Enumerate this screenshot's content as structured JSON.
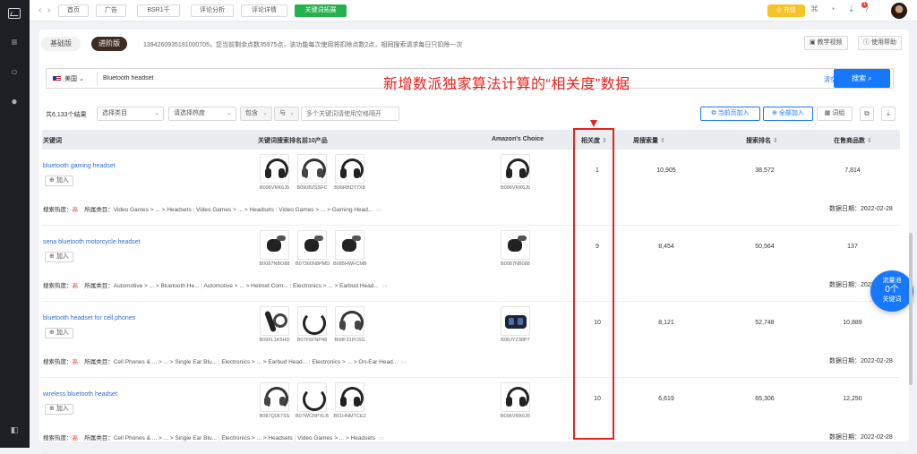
{
  "topbar": {
    "tabs": [
      "首页",
      "广告",
      "BSR1千",
      "评论分析",
      "评论详情",
      "关键词拓展"
    ],
    "charge": "充值",
    "notification_count": "1"
  },
  "header": {
    "version_basic": "基础版",
    "version_adv": "进阶版",
    "notice": "1394260935181000705，您当前剩余点数35975点，该功能每次使用将扣除点数2点，相同搜索请求每日只扣除一次",
    "tutorial": "教学视频",
    "help": "使用帮助"
  },
  "search": {
    "country": "美国",
    "value": "Bluetooth headset",
    "clear": "清空",
    "button": "搜索"
  },
  "filters": {
    "total": "共6,133个结果",
    "category": "选择类目",
    "heat": "请选择热度",
    "include": "包含",
    "and": "与",
    "keyword_placeholder": "多个关键词请使用空格隔开",
    "add_page": "当前页加入",
    "add_all": "全部加入",
    "words": "词组"
  },
  "annotation": "新增数派独家算法计算的“相关度”数据",
  "table": {
    "headers": [
      "关键词",
      "关键词搜索排名前10产品",
      "Amazon's Choice",
      "相关度",
      "周搜索量",
      "搜索排名",
      "在售商品数"
    ],
    "add_label": "加入",
    "rows": [
      {
        "keyword": "bluetooth gaming headset",
        "products": [
          "B096VRK6J5",
          "B090B2SSFC",
          "B06RBDT7X8"
        ],
        "choice": "B096VRK6J5",
        "relevance": "1",
        "weekly": "10,905",
        "rank": "38,572",
        "count": "7,814",
        "heat_label": "搜索热度：",
        "heat": "高",
        "cat_label": "所属类目：",
        "cats": [
          "Video Games > ... > Headsets",
          "Video Games > ... > Headsets",
          "Video Games > ... > Gaming Head..."
        ],
        "date": "数据日期：2022-02-28"
      },
      {
        "keyword": "sena bluetooth motorcycle headset",
        "products": [
          "B0087NBO88",
          "B07360N8PMD",
          "B085HWFCMB"
        ],
        "choice": "B0087NB088",
        "relevance": "9",
        "weekly": "8,454",
        "rank": "50,564",
        "count": "137",
        "heat_label": "搜索热度：",
        "heat": "高",
        "cat_label": "所属类目：",
        "cats": [
          "Automotive > ... > Bluetooth He...",
          "Automotive > ... > Helmet Com...",
          "Electronics > ... > Earbud Head..."
        ],
        "date": "数据日期：2022-02-28"
      },
      {
        "keyword": "bluetooth headset for cell phones",
        "products": [
          "B09FL1K5HD",
          "B07F6FNP48",
          "B09F31PC6G"
        ],
        "choice": "B08JYZ38P7",
        "relevance": "10",
        "weekly": "8,121",
        "rank": "52,748",
        "count": "10,889",
        "heat_label": "搜索热度：",
        "heat": "高",
        "cat_label": "所属类目：",
        "cats": [
          "Cell Phones & ... > ... > Single Ear Blu...",
          "Electronics > ... > Earbud Head...",
          "Electronics > ... > On-Ear Head..."
        ],
        "date": "数据日期：2022-02-28"
      },
      {
        "keyword": "wireless bluetooth headset",
        "products": [
          "B087Q067SS",
          "B07WCRPXLB",
          "B01HNMTCE2"
        ],
        "choice": "B096VRK6J5",
        "relevance": "10",
        "weekly": "6,619",
        "rank": "65,306",
        "count": "12,250",
        "heat_label": "搜索热度：",
        "heat": "高",
        "cat_label": "所属类目：",
        "cats": [
          "Cell Phones & ... > ... > Single Ear Blu...",
          "Electronics > ... > Headsets",
          "Video Games > ... > Headsets"
        ],
        "date": "数据日期：2022-02-28"
      }
    ]
  },
  "float": {
    "line1": "流量池",
    "line2": "0个",
    "line3": "关键词"
  }
}
